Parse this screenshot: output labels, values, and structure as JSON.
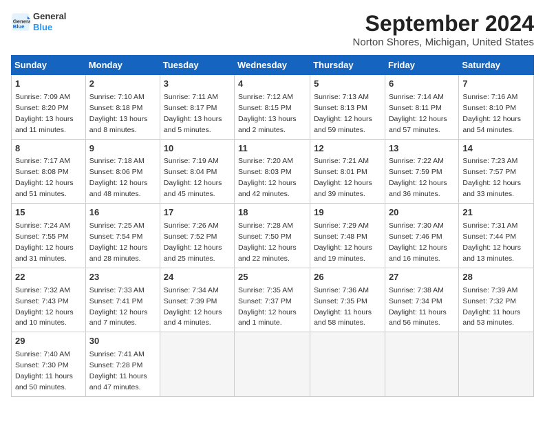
{
  "header": {
    "title": "September 2024",
    "subtitle": "Norton Shores, Michigan, United States",
    "logo_line1": "General",
    "logo_line2": "Blue"
  },
  "weekdays": [
    "Sunday",
    "Monday",
    "Tuesday",
    "Wednesday",
    "Thursday",
    "Friday",
    "Saturday"
  ],
  "weeks": [
    [
      {
        "day": 1,
        "sunrise": "7:09 AM",
        "sunset": "8:20 PM",
        "daylight": "13 hours and 11 minutes."
      },
      {
        "day": 2,
        "sunrise": "7:10 AM",
        "sunset": "8:18 PM",
        "daylight": "13 hours and 8 minutes."
      },
      {
        "day": 3,
        "sunrise": "7:11 AM",
        "sunset": "8:17 PM",
        "daylight": "13 hours and 5 minutes."
      },
      {
        "day": 4,
        "sunrise": "7:12 AM",
        "sunset": "8:15 PM",
        "daylight": "13 hours and 2 minutes."
      },
      {
        "day": 5,
        "sunrise": "7:13 AM",
        "sunset": "8:13 PM",
        "daylight": "12 hours and 59 minutes."
      },
      {
        "day": 6,
        "sunrise": "7:14 AM",
        "sunset": "8:11 PM",
        "daylight": "12 hours and 57 minutes."
      },
      {
        "day": 7,
        "sunrise": "7:16 AM",
        "sunset": "8:10 PM",
        "daylight": "12 hours and 54 minutes."
      }
    ],
    [
      {
        "day": 8,
        "sunrise": "7:17 AM",
        "sunset": "8:08 PM",
        "daylight": "12 hours and 51 minutes."
      },
      {
        "day": 9,
        "sunrise": "7:18 AM",
        "sunset": "8:06 PM",
        "daylight": "12 hours and 48 minutes."
      },
      {
        "day": 10,
        "sunrise": "7:19 AM",
        "sunset": "8:04 PM",
        "daylight": "12 hours and 45 minutes."
      },
      {
        "day": 11,
        "sunrise": "7:20 AM",
        "sunset": "8:03 PM",
        "daylight": "12 hours and 42 minutes."
      },
      {
        "day": 12,
        "sunrise": "7:21 AM",
        "sunset": "8:01 PM",
        "daylight": "12 hours and 39 minutes."
      },
      {
        "day": 13,
        "sunrise": "7:22 AM",
        "sunset": "7:59 PM",
        "daylight": "12 hours and 36 minutes."
      },
      {
        "day": 14,
        "sunrise": "7:23 AM",
        "sunset": "7:57 PM",
        "daylight": "12 hours and 33 minutes."
      }
    ],
    [
      {
        "day": 15,
        "sunrise": "7:24 AM",
        "sunset": "7:55 PM",
        "daylight": "12 hours and 31 minutes."
      },
      {
        "day": 16,
        "sunrise": "7:25 AM",
        "sunset": "7:54 PM",
        "daylight": "12 hours and 28 minutes."
      },
      {
        "day": 17,
        "sunrise": "7:26 AM",
        "sunset": "7:52 PM",
        "daylight": "12 hours and 25 minutes."
      },
      {
        "day": 18,
        "sunrise": "7:28 AM",
        "sunset": "7:50 PM",
        "daylight": "12 hours and 22 minutes."
      },
      {
        "day": 19,
        "sunrise": "7:29 AM",
        "sunset": "7:48 PM",
        "daylight": "12 hours and 19 minutes."
      },
      {
        "day": 20,
        "sunrise": "7:30 AM",
        "sunset": "7:46 PM",
        "daylight": "12 hours and 16 minutes."
      },
      {
        "day": 21,
        "sunrise": "7:31 AM",
        "sunset": "7:44 PM",
        "daylight": "12 hours and 13 minutes."
      }
    ],
    [
      {
        "day": 22,
        "sunrise": "7:32 AM",
        "sunset": "7:43 PM",
        "daylight": "12 hours and 10 minutes."
      },
      {
        "day": 23,
        "sunrise": "7:33 AM",
        "sunset": "7:41 PM",
        "daylight": "12 hours and 7 minutes."
      },
      {
        "day": 24,
        "sunrise": "7:34 AM",
        "sunset": "7:39 PM",
        "daylight": "12 hours and 4 minutes."
      },
      {
        "day": 25,
        "sunrise": "7:35 AM",
        "sunset": "7:37 PM",
        "daylight": "12 hours and 1 minute."
      },
      {
        "day": 26,
        "sunrise": "7:36 AM",
        "sunset": "7:35 PM",
        "daylight": "11 hours and 58 minutes."
      },
      {
        "day": 27,
        "sunrise": "7:38 AM",
        "sunset": "7:34 PM",
        "daylight": "11 hours and 56 minutes."
      },
      {
        "day": 28,
        "sunrise": "7:39 AM",
        "sunset": "7:32 PM",
        "daylight": "11 hours and 53 minutes."
      }
    ],
    [
      {
        "day": 29,
        "sunrise": "7:40 AM",
        "sunset": "7:30 PM",
        "daylight": "11 hours and 50 minutes."
      },
      {
        "day": 30,
        "sunrise": "7:41 AM",
        "sunset": "7:28 PM",
        "daylight": "11 hours and 47 minutes."
      },
      null,
      null,
      null,
      null,
      null
    ]
  ]
}
